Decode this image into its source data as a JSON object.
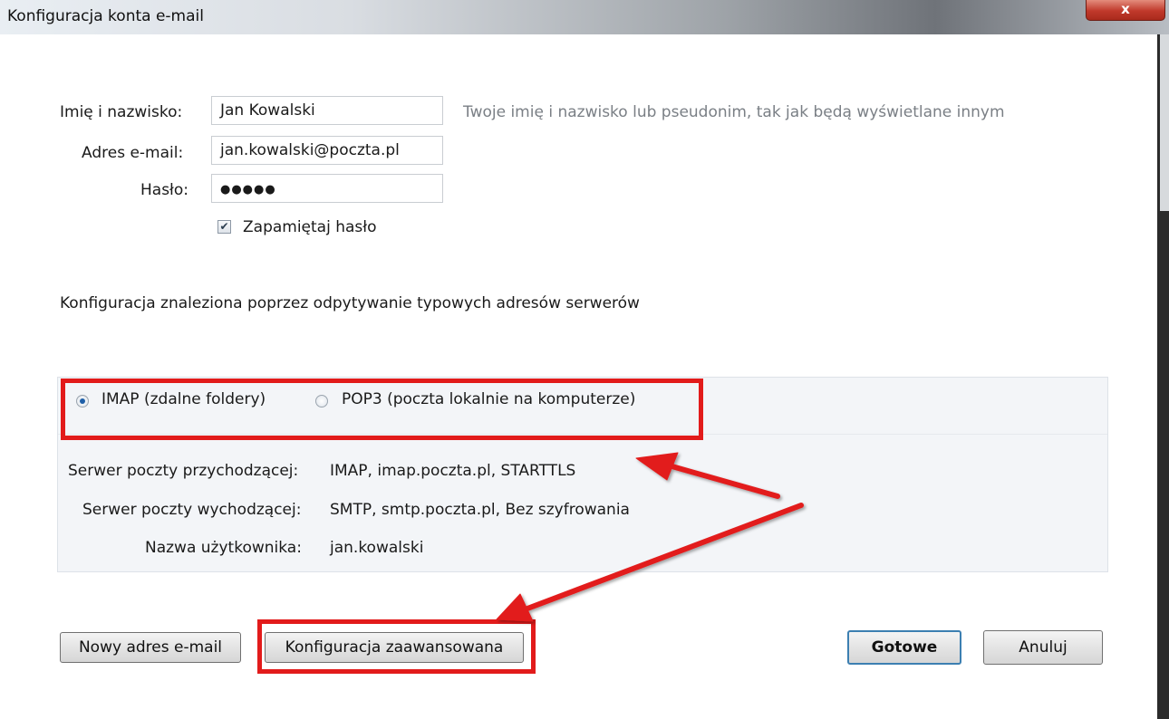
{
  "window": {
    "title": "Konfiguracja konta e-mail",
    "close_label": "x"
  },
  "form": {
    "name_label": "Imię i nazwisko:",
    "name_value": "Jan Kowalski",
    "name_hint": "Twoje imię i nazwisko lub pseudonim, tak jak będą wyświetlane innym",
    "email_label": "Adres e-mail:",
    "email_value": "jan.kowalski@poczta.pl",
    "password_label": "Hasło:",
    "password_value": "●●●●●",
    "remember_label": "Zapamiętaj hasło",
    "remember_checked": true
  },
  "status": {
    "message": "Konfiguracja znaleziona poprzez odpytywanie typowych adresów serwerów"
  },
  "protocol": {
    "options": [
      {
        "label": "IMAP (zdalne foldery)",
        "selected": true
      },
      {
        "label": "POP3 (poczta lokalnie na komputerze)",
        "selected": false
      }
    ]
  },
  "servers": {
    "incoming_label": "Serwer poczty przychodzącej:",
    "incoming_value": "IMAP, imap.poczta.pl, STARTTLS",
    "outgoing_label": "Serwer poczty wychodzącej:",
    "outgoing_value": "SMTP, smtp.poczta.pl, Bez szyfrowania",
    "username_label": "Nazwa użytkownika:",
    "username_value": "jan.kowalski"
  },
  "buttons": {
    "new_address": "Nowy adres e-mail",
    "advanced": "Konfiguracja zaawansowana",
    "done": "Gotowe",
    "cancel": "Anuluj"
  },
  "colors": {
    "annotation": "#e21b1b",
    "hint": "#7a7f85",
    "panel_bg": "#f3f5f8",
    "default_button_border": "#3c7fb1"
  },
  "icons": {
    "checkbox": "checkmark-icon",
    "radio": "radio-dot-icon",
    "annotation_arrows": "red-arrow-icon"
  }
}
